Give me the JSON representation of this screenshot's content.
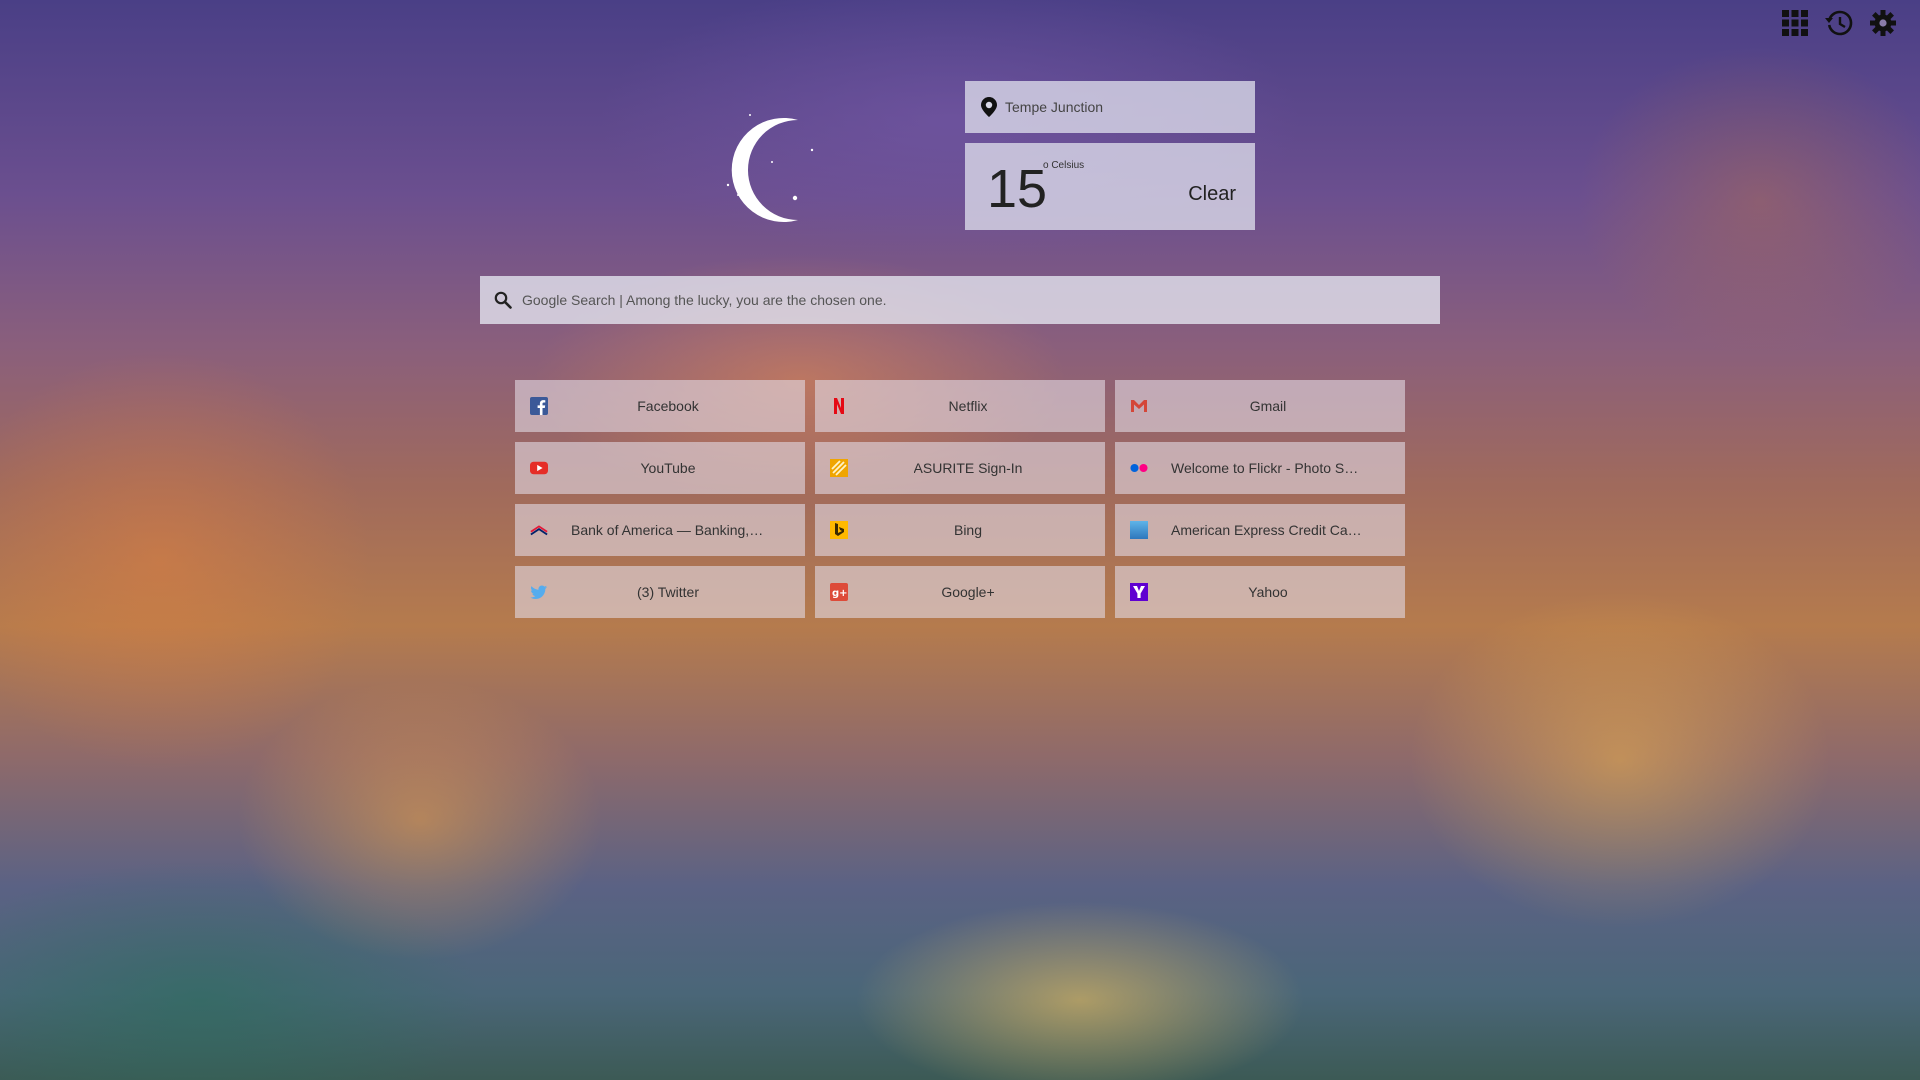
{
  "topbar": {
    "icons": [
      "apps-grid-icon",
      "history-icon",
      "settings-gear-icon"
    ]
  },
  "weather": {
    "location": "Tempe Junction",
    "temperature": "15",
    "unit": "o Celsius",
    "condition": "Clear",
    "condition_icon": "moon-night-icon"
  },
  "search": {
    "placeholder": "Google Search | Among the lucky, you are the chosen one."
  },
  "tiles": [
    {
      "label": "Facebook",
      "icon": "facebook-icon",
      "color": "#3b5998"
    },
    {
      "label": "Netflix",
      "icon": "netflix-icon",
      "color": "#e50914"
    },
    {
      "label": "Gmail",
      "icon": "gmail-icon",
      "color": "#d44638"
    },
    {
      "label": "YouTube",
      "icon": "youtube-icon",
      "color": "#e52d27"
    },
    {
      "label": "ASURITE Sign-In",
      "icon": "asurite-icon",
      "color": "#f0a500"
    },
    {
      "label": "Welcome to Flickr - Photo Sh…",
      "icon": "flickr-icon",
      "color": "#0063dc"
    },
    {
      "label": "Bank of America — Banking, …",
      "icon": "bank-of-america-icon",
      "color": "#e31837"
    },
    {
      "label": "Bing",
      "icon": "bing-icon",
      "color": "#ffb900"
    },
    {
      "label": "American Express Credit Car…",
      "icon": "american-express-icon",
      "color": "#2e77bc"
    },
    {
      "label": "(3) Twitter",
      "icon": "twitter-icon",
      "color": "#55acee"
    },
    {
      "label": "Google+",
      "icon": "google-plus-icon",
      "color": "#dd4b39"
    },
    {
      "label": "Yahoo",
      "icon": "yahoo-icon",
      "color": "#5f01d1"
    }
  ]
}
